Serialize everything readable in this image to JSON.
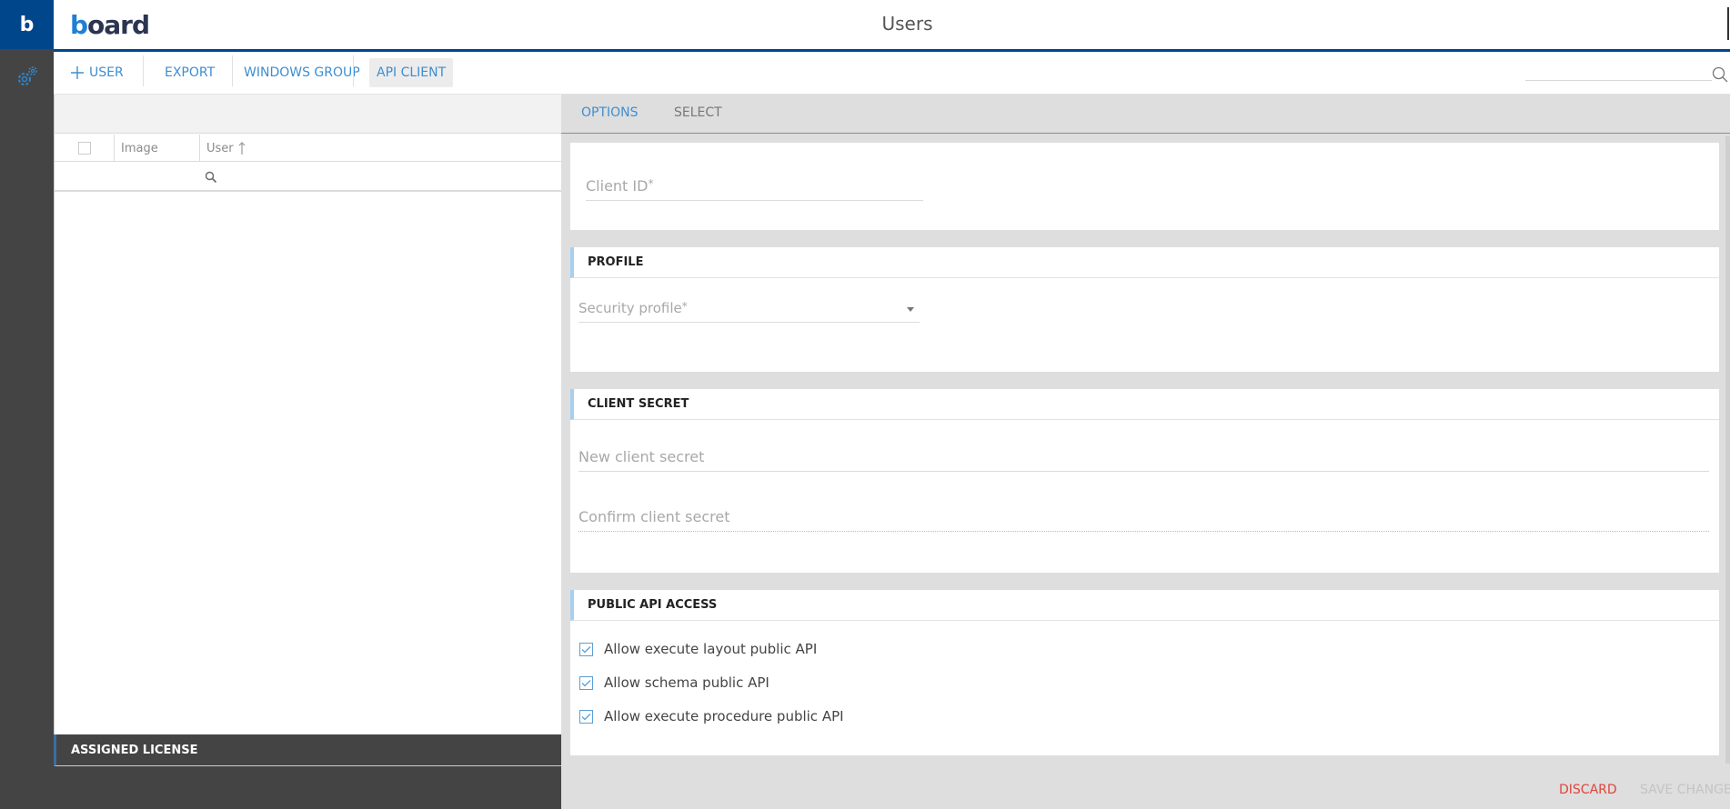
{
  "app": {
    "logo_letter": "b",
    "brand_prefix": "b",
    "brand_rest": "oard",
    "page_title": "Users",
    "colors": {
      "brand_blue": "#00468b",
      "accent": "#3d8ed1",
      "discard": "#e0453a",
      "disabled": "#c4c4c4",
      "sidebar": "#444444"
    }
  },
  "sidebar": {
    "items": [
      {
        "icon": "gears-icon",
        "label": "Settings"
      }
    ]
  },
  "toolbar": {
    "add_user_label": "USER",
    "export_label": "EXPORT",
    "windows_group_label": "WINDOWS GROUP",
    "api_client_label": "API CLIENT",
    "search_placeholder": ""
  },
  "user_list": {
    "columns": [
      "Image",
      "User"
    ],
    "sort": {
      "column": "User",
      "direction": "ascending"
    },
    "rows": [],
    "assigned_license_label": "ASSIGNED LICENSE"
  },
  "detail": {
    "tabs": [
      {
        "label": "OPTIONS",
        "active": true
      },
      {
        "label": "SELECT",
        "active": false
      }
    ],
    "client_id": {
      "label": "Client ID",
      "required_mark": "*",
      "value": ""
    },
    "profile": {
      "heading": "PROFILE",
      "security_profile": {
        "label": "Security profile",
        "required_mark": "*",
        "value": ""
      }
    },
    "client_secret": {
      "heading": "CLIENT SECRET",
      "new_placeholder": "New client secret",
      "confirm_placeholder": "Confirm client secret"
    },
    "public_api": {
      "heading": "PUBLIC API ACCESS",
      "options": [
        {
          "label": "Allow execute layout public API",
          "checked": true
        },
        {
          "label": "Allow schema public API",
          "checked": true
        },
        {
          "label": "Allow execute procedure public API",
          "checked": true
        }
      ]
    },
    "footer": {
      "discard_label": "DISCARD",
      "save_label": "SAVE CHANGES"
    }
  }
}
